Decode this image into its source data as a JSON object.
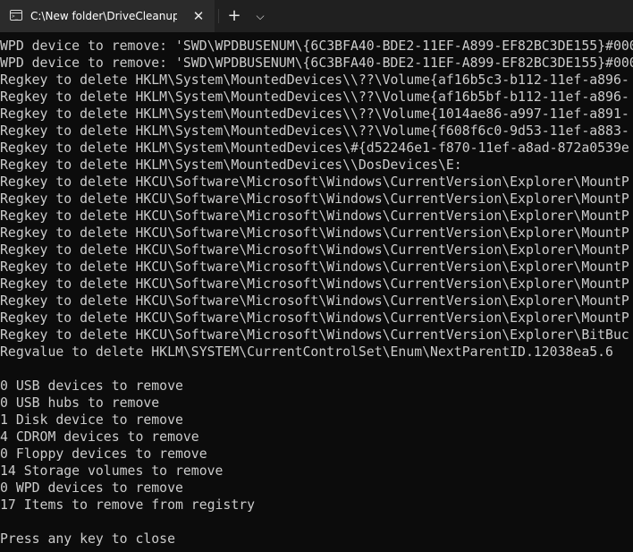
{
  "tab": {
    "title": "C:\\New folder\\DriveCleanup\\",
    "icon": "terminal-icon",
    "close_label": "✕",
    "new_tab_label": "+",
    "dropdown_label": "⌵"
  },
  "colors": {
    "background": "#0c0c0c",
    "text": "#cccccc",
    "tabbar": "#202020",
    "active_tab": "#2b2b2b"
  },
  "terminal": {
    "lines": [
      "WPD device to remove: 'SWD\\WPDBUSENUM\\{6C3BFA40-BDE2-11EF-A899-EF82BC3DE155}#000",
      "WPD device to remove: 'SWD\\WPDBUSENUM\\{6C3BFA40-BDE2-11EF-A899-EF82BC3DE155}#000",
      "Regkey to delete HKLM\\System\\MountedDevices\\\\??\\Volume{af16b5c3-b112-11ef-a896-",
      "Regkey to delete HKLM\\System\\MountedDevices\\\\??\\Volume{af16b5bf-b112-11ef-a896-",
      "Regkey to delete HKLM\\System\\MountedDevices\\\\??\\Volume{1014ae86-a997-11ef-a891-",
      "Regkey to delete HKLM\\System\\MountedDevices\\\\??\\Volume{f608f6c0-9d53-11ef-a883-",
      "Regkey to delete HKLM\\System\\MountedDevices\\#{d52246e1-f870-11ef-a8ad-872a0539e",
      "Regkey to delete HKLM\\System\\MountedDevices\\\\DosDevices\\E:",
      "Regkey to delete HKCU\\Software\\Microsoft\\Windows\\CurrentVersion\\Explorer\\MountP",
      "Regkey to delete HKCU\\Software\\Microsoft\\Windows\\CurrentVersion\\Explorer\\MountP",
      "Regkey to delete HKCU\\Software\\Microsoft\\Windows\\CurrentVersion\\Explorer\\MountP",
      "Regkey to delete HKCU\\Software\\Microsoft\\Windows\\CurrentVersion\\Explorer\\MountP",
      "Regkey to delete HKCU\\Software\\Microsoft\\Windows\\CurrentVersion\\Explorer\\MountP",
      "Regkey to delete HKCU\\Software\\Microsoft\\Windows\\CurrentVersion\\Explorer\\MountP",
      "Regkey to delete HKCU\\Software\\Microsoft\\Windows\\CurrentVersion\\Explorer\\MountP",
      "Regkey to delete HKCU\\Software\\Microsoft\\Windows\\CurrentVersion\\Explorer\\MountP",
      "Regkey to delete HKCU\\Software\\Microsoft\\Windows\\CurrentVersion\\Explorer\\MountP",
      "Regkey to delete HKCU\\Software\\Microsoft\\Windows\\CurrentVersion\\Explorer\\BitBuc",
      "Regvalue to delete HKLM\\SYSTEM\\CurrentControlSet\\Enum\\NextParentID.12038ea5.6",
      "",
      "0 USB devices to remove",
      "0 USB hubs to remove",
      "1 Disk device to remove",
      "4 CDROM devices to remove",
      "0 Floppy devices to remove",
      "14 Storage volumes to remove",
      "0 WPD devices to remove",
      "17 Items to remove from registry",
      "",
      "Press any key to close"
    ]
  }
}
